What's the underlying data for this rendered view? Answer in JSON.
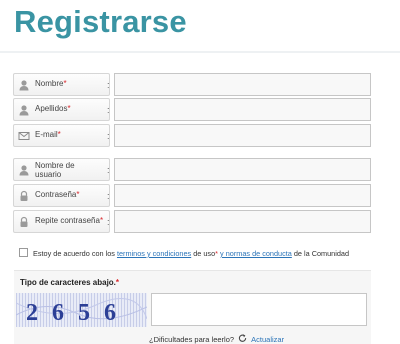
{
  "page": {
    "title": "Registrarse"
  },
  "form": {
    "fields": [
      {
        "label": "Nombre",
        "required": "*",
        "colon": ":",
        "icon": "user-icon",
        "value": ""
      },
      {
        "label": "Apellidos",
        "required": "*",
        "colon": ":",
        "icon": "user-icon",
        "value": ""
      },
      {
        "label": "E-mail",
        "required": "*",
        "colon": ":",
        "icon": "envelope-icon",
        "value": ""
      },
      {
        "label": "Nombre de usuario",
        "required": "",
        "colon": ":",
        "icon": "user-icon",
        "value": ""
      },
      {
        "label": "Contraseña",
        "required": "*",
        "colon": ":",
        "icon": "lock-icon",
        "value": ""
      },
      {
        "label": "Repite contraseña",
        "required": "*",
        "colon": ":",
        "icon": "lock-icon",
        "value": ""
      }
    ],
    "username_label_line1": "Nombre de",
    "username_label_line2": "usuario"
  },
  "terms": {
    "checked": false,
    "text_before": "Estoy de acuerdo con los",
    "terms_link": "terminos y condiciones",
    "text_middle": "de uso",
    "required": "*",
    "conduct_link": "y normas de conducta",
    "text_after": "de la Comunidad"
  },
  "captcha": {
    "title": "Tipo de caracteres abajo.",
    "required": "*",
    "image_text": "2656",
    "input_value": "",
    "help_text": "¿Dificultades para leerlo?",
    "refresh_icon": "refresh-icon",
    "refresh_label": "Actualizar"
  },
  "colors": {
    "title": "#3a94a3",
    "required": "#d9262b",
    "link": "#2b74b8"
  }
}
